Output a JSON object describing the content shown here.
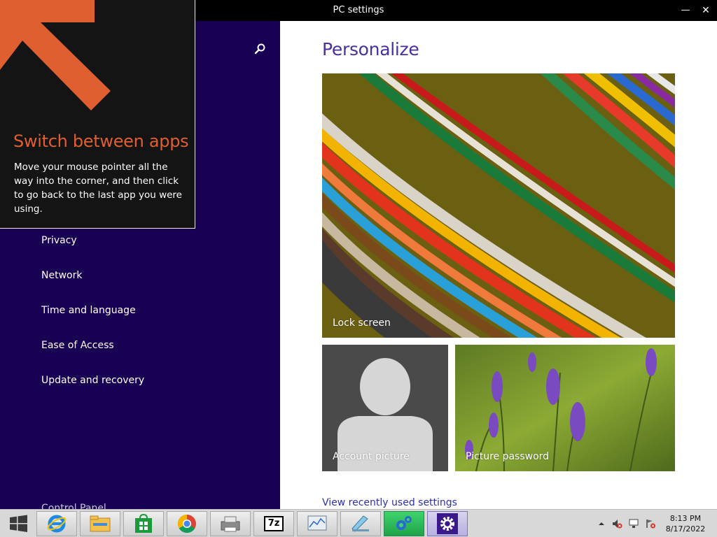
{
  "window": {
    "title": "PC settings",
    "minimize_glyph": "—",
    "close_glyph": "✕"
  },
  "nav": {
    "items": [
      {
        "label": "Privacy"
      },
      {
        "label": "Network"
      },
      {
        "label": "Time and language"
      },
      {
        "label": "Ease of Access"
      },
      {
        "label": "Update and recovery"
      }
    ],
    "control_panel": "Control Panel",
    "search_icon": "search-icon"
  },
  "tip": {
    "title": "Switch between apps",
    "body": "Move your mouse pointer all the way into the corner, and then click to go back to the last app you were using.",
    "accent": "#e05f30"
  },
  "content": {
    "title": "Personalize",
    "tiles": {
      "lock_screen": "Lock screen",
      "account_picture": "Account picture",
      "picture_password": "Picture password"
    },
    "recent_link": "View recently used settings"
  },
  "taskbar": {
    "apps": [
      {
        "name": "internet-explorer-icon"
      },
      {
        "name": "file-explorer-icon"
      },
      {
        "name": "store-icon"
      },
      {
        "name": "chrome-icon"
      },
      {
        "name": "printer-scanner-icon"
      },
      {
        "name": "7zip-icon",
        "text": "7z"
      },
      {
        "name": "performance-monitor-icon"
      },
      {
        "name": "notepad-icon"
      },
      {
        "name": "control-panel-gears-icon"
      },
      {
        "name": "pc-settings-gear-icon"
      }
    ],
    "clock": {
      "time": "8:13 PM",
      "date": "8/17/2022"
    }
  },
  "colors": {
    "nav_background": "#180052",
    "title_accent": "#4b2fa0",
    "link": "#2a2fb0"
  }
}
